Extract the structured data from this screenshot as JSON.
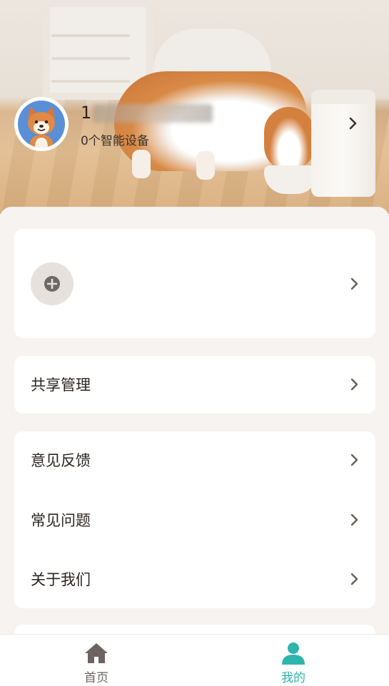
{
  "profile": {
    "phone_prefix": "1",
    "device_count": "0个智能设备"
  },
  "menu": {
    "share_management": "共享管理",
    "feedback": "意见反馈",
    "faq": "常见问题",
    "about_us": "关于我们"
  },
  "tabbar": {
    "home": "首页",
    "mine": "我的"
  },
  "icons": {
    "add": "plus-icon",
    "chevron": "chevron-right-icon",
    "home": "home-icon",
    "mine": "user-icon"
  },
  "colors": {
    "accent": "#2db5ad",
    "tab_inactive": "#6b6460",
    "background": "#f7f3f0"
  }
}
